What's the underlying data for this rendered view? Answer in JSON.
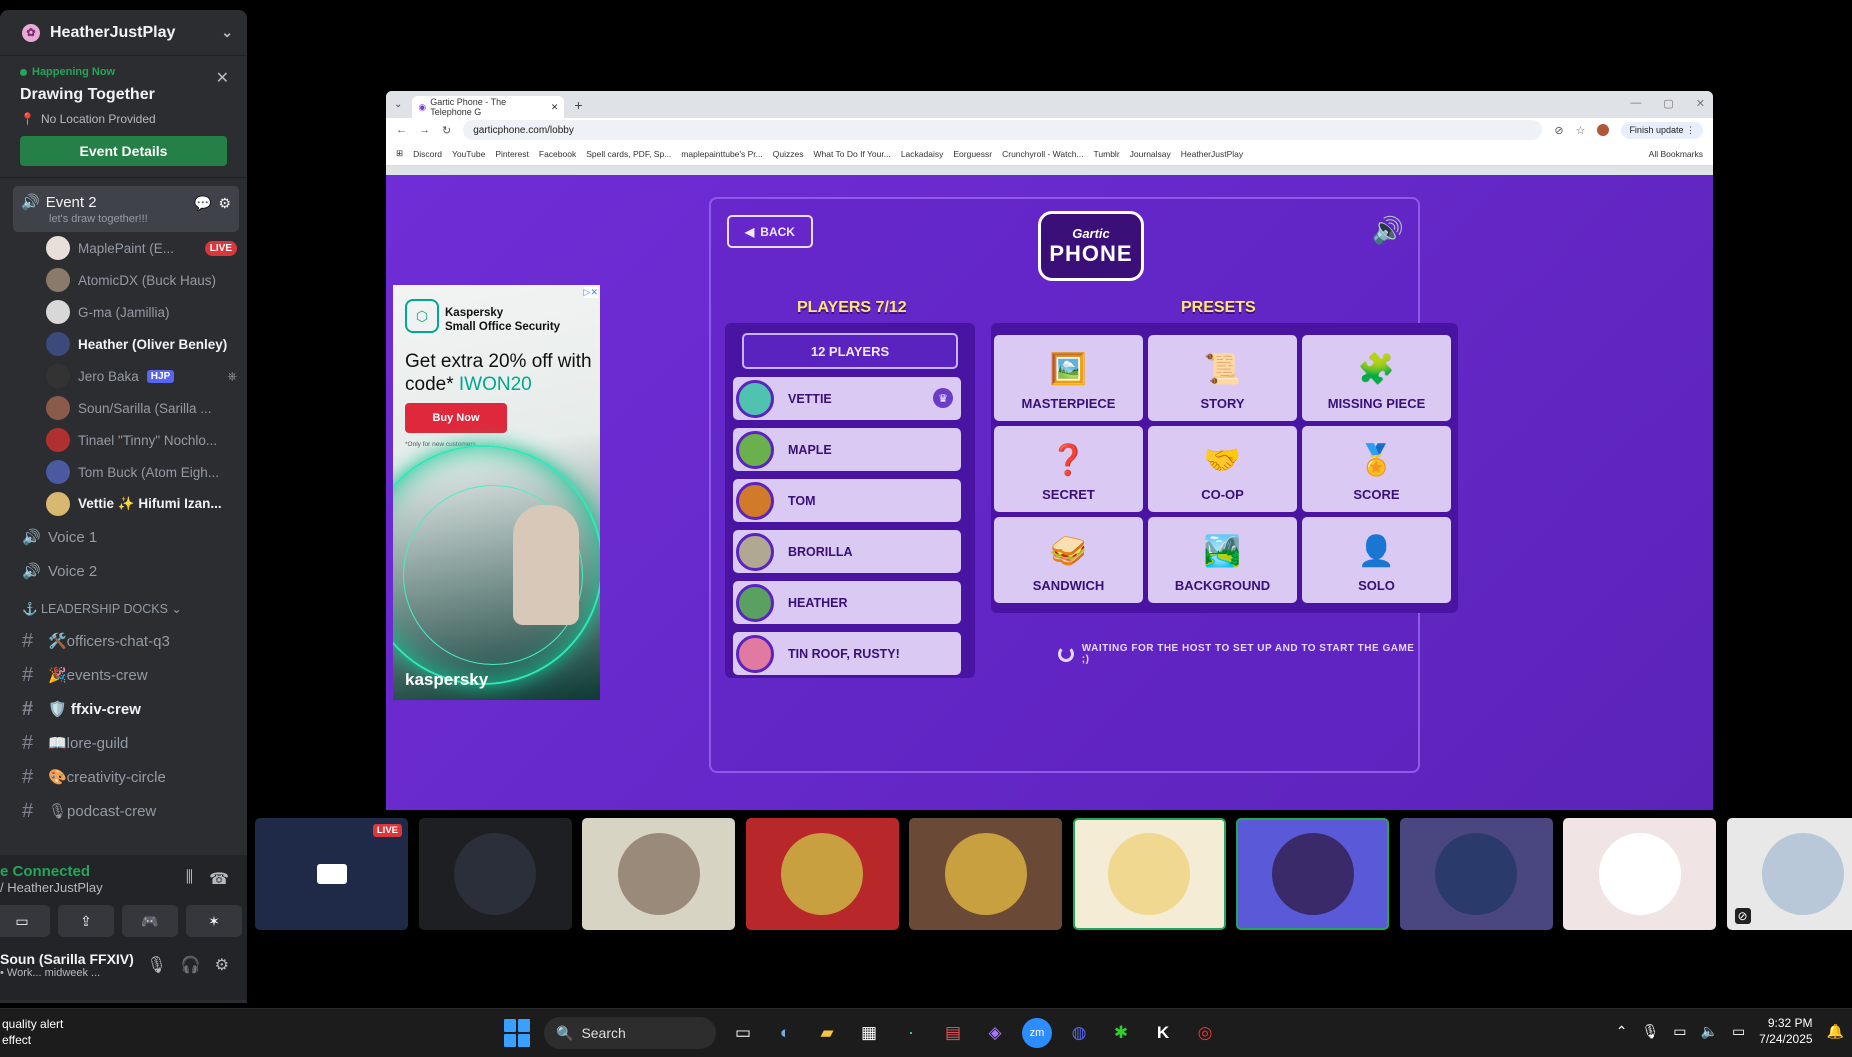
{
  "discord": {
    "server_name": "HeatherJustPlay",
    "event": {
      "status": "Happening Now",
      "title": "Drawing Together",
      "location": "No Location Provided",
      "button": "Event Details"
    },
    "active_voice": {
      "name": "Event 2",
      "status": "let's draw together!!!"
    },
    "members": [
      {
        "name": "MaplePaint (E...",
        "badge": "LIVE",
        "bold": false,
        "color": "#e8e0d8"
      },
      {
        "name": "AtomicDX (Buck Haus)",
        "badge": "",
        "bold": false,
        "color": "#8a7a6a"
      },
      {
        "name": "G-ma (Jamillia)",
        "badge": "",
        "bold": false,
        "color": "#d8d8d8"
      },
      {
        "name": "Heather (Oliver Benley)",
        "badge": "",
        "bold": true,
        "color": "#3b4a7a"
      },
      {
        "name": "Jero Baka",
        "badge": "HJP",
        "bold": false,
        "color": "#333333"
      },
      {
        "name": "Soun/Sarilla (Sarilla ...",
        "badge": "",
        "bold": false,
        "color": "#8a5a4a"
      },
      {
        "name": "Tinael \"Tinny\" Nochlo...",
        "badge": "",
        "bold": false,
        "color": "#b03030"
      },
      {
        "name": "Tom Buck (Atom Eigh...",
        "badge": "",
        "bold": false,
        "color": "#4a5aa0"
      },
      {
        "name": "Vettie ✨ Hifumi Izan...",
        "badge": "",
        "bold": true,
        "color": "#d8b870"
      }
    ],
    "voice_channels": [
      "Voice 1",
      "Voice 2"
    ],
    "category": "⚓ LEADERSHIP DOCKS ⌄",
    "text_channels": [
      {
        "name": "🛠️officers-chat-q3",
        "bold": false
      },
      {
        "name": "🎉events-crew",
        "bold": false
      },
      {
        "name": "🛡️ ffxiv-crew",
        "bold": true
      },
      {
        "name": "📖lore-guild",
        "bold": false
      },
      {
        "name": "🎨creativity-circle",
        "bold": false
      },
      {
        "name": "🎙podcast-crew",
        "bold": false
      }
    ],
    "rtc": {
      "status": "e Connected",
      "server": "/ HeatherJustPlay"
    },
    "user": {
      "name": "Soun (Sarilla FFXIV)",
      "status": "• Work... midweek ..."
    }
  },
  "browser": {
    "tab_title": "Gartic Phone - The Telephone G",
    "url": "garticphone.com/lobby",
    "update_button": "Finish update",
    "bookmarks": [
      "Discord",
      "YouTube",
      "Pinterest",
      "Facebook",
      "Spell cards, PDF, Sp...",
      "maplepainttube's Pr...",
      "Quizzes",
      "What To Do If Your...",
      "Lackadaisy",
      "Eorguessr",
      "Crunchyroll - Watch...",
      "Tumblr",
      "Journalsay",
      "HeatherJustPlay"
    ],
    "all_bookmarks": "All Bookmarks"
  },
  "ad": {
    "brand": "Kaspersky",
    "brand_sub": "Small Office Security",
    "headline": "Get extra 20% off with code*",
    "code": "IWON20",
    "buy": "Buy Now",
    "fine": "*Only for new customers",
    "logo": "kaspersky"
  },
  "game": {
    "back": "BACK",
    "logo_top": "Gartic",
    "logo_bottom": "PHONE",
    "players_title": "PLAYERS 7/12",
    "players_count_button": "12 PLAYERS",
    "players": [
      {
        "name": "VETTIE",
        "host": true,
        "color": "#4fc2b0"
      },
      {
        "name": "MAPLE",
        "host": false,
        "color": "#6ab04c"
      },
      {
        "name": "TOM",
        "host": false,
        "color": "#d07a2a"
      },
      {
        "name": "BRORILLA",
        "host": false,
        "color": "#b0a890"
      },
      {
        "name": "HEATHER",
        "host": false,
        "color": "#5aa060"
      },
      {
        "name": "TIN ROOF, RUSTY!",
        "host": false,
        "color": "#e07aa0"
      }
    ],
    "presets_title": "PRESETS",
    "presets": [
      {
        "label": "MASTERPIECE",
        "icon": "🖼️"
      },
      {
        "label": "STORY",
        "icon": "📜"
      },
      {
        "label": "MISSING PIECE",
        "icon": "🧩"
      },
      {
        "label": "SECRET",
        "icon": "❓"
      },
      {
        "label": "CO-OP",
        "icon": "🤝"
      },
      {
        "label": "SCORE",
        "icon": "🏅"
      },
      {
        "label": "SANDWICH",
        "icon": "🥪"
      },
      {
        "label": "BACKGROUND",
        "icon": "🏞️"
      },
      {
        "label": "SOLO",
        "icon": "👤"
      }
    ],
    "waiting": "WAITING FOR THE HOST TO SET UP AND TO START THE GAME ;)"
  },
  "stream_tiles": [
    {
      "bg": "#1e2a48",
      "circle": "#2a3a6a",
      "live": "LIVE"
    },
    {
      "bg": "#1e1f22",
      "circle": "#2a2f3a",
      "live": ""
    },
    {
      "bg": "#d8d4c4",
      "circle": "#9a8a7a",
      "live": ""
    },
    {
      "bg": "#b8282a",
      "circle": "#c8a040",
      "live": ""
    },
    {
      "bg": "#6a4a36",
      "circle": "#c8a040",
      "live": ""
    },
    {
      "bg": "#f4ecd4",
      "circle": "#f0d890",
      "live": ""
    },
    {
      "bg": "#5a5ad8",
      "circle": "#3a2a6a",
      "live": ""
    },
    {
      "bg": "#4a4680",
      "circle": "#2a3a6a",
      "live": ""
    },
    {
      "bg": "#f0e4e4",
      "circle": "#ffffff",
      "live": ""
    },
    {
      "bg": "#e8e8e8",
      "circle": "#b8c8d8",
      "live": ""
    }
  ],
  "taskbar": {
    "notice_line1": "quality alert",
    "notice_line2": "effect",
    "search": "Search",
    "time": "9:32 PM",
    "date": "7/24/2025"
  }
}
